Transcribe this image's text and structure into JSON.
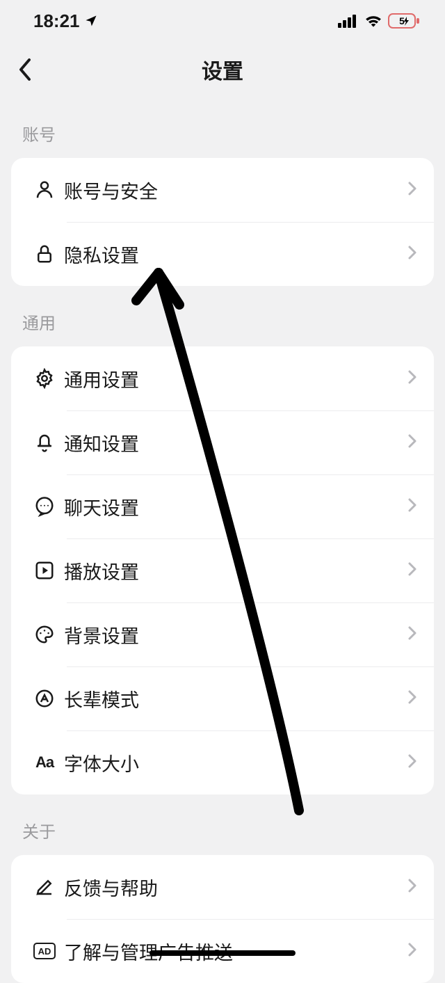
{
  "status": {
    "time": "18:21",
    "battery": "5"
  },
  "nav": {
    "title": "设置"
  },
  "sections": [
    {
      "label": "账号",
      "items": [
        {
          "icon": "user-icon",
          "label": "账号与安全",
          "name": "row-account-security"
        },
        {
          "icon": "lock-icon",
          "label": "隐私设置",
          "name": "row-privacy"
        }
      ]
    },
    {
      "label": "通用",
      "items": [
        {
          "icon": "gear-icon",
          "label": "通用设置",
          "name": "row-general"
        },
        {
          "icon": "bell-icon",
          "label": "通知设置",
          "name": "row-notification"
        },
        {
          "icon": "chat-icon",
          "label": "聊天设置",
          "name": "row-chat"
        },
        {
          "icon": "play-icon",
          "label": "播放设置",
          "name": "row-playback"
        },
        {
          "icon": "palette-icon",
          "label": "背景设置",
          "name": "row-background"
        },
        {
          "icon": "elder-icon",
          "label": "长辈模式",
          "name": "row-elder-mode"
        },
        {
          "icon": "font-icon",
          "label": "字体大小",
          "name": "row-font-size"
        }
      ]
    },
    {
      "label": "关于",
      "items": [
        {
          "icon": "pencil-icon",
          "label": "反馈与帮助",
          "name": "row-feedback"
        },
        {
          "icon": "ad-icon",
          "label": "了解与管理广告推送",
          "name": "row-ads"
        }
      ]
    }
  ]
}
